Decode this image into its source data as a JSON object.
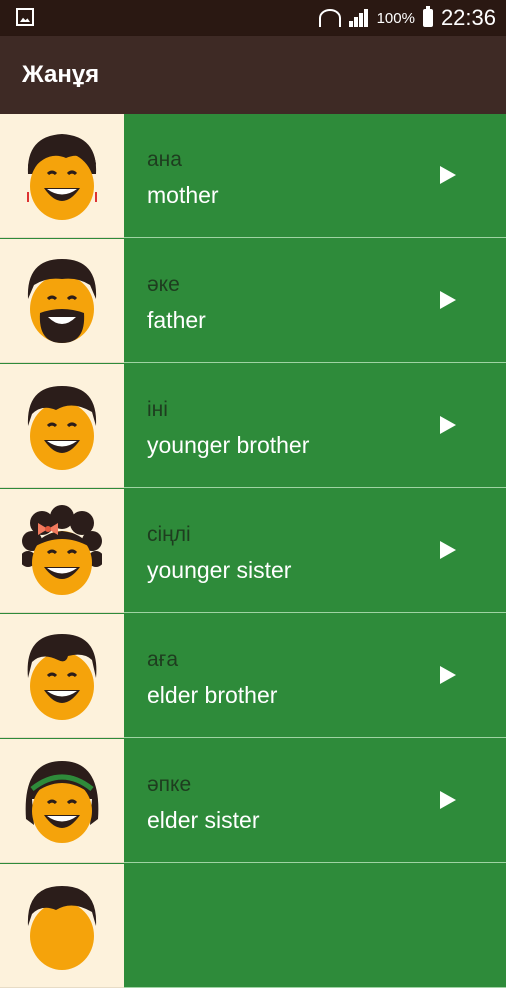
{
  "status": {
    "battery_pct": "100%",
    "time": "22:36"
  },
  "appbar": {
    "title": "Жанұя"
  },
  "items": [
    {
      "kz": "ана",
      "en": "mother",
      "avatar": "mother-face"
    },
    {
      "kz": "әке",
      "en": "father",
      "avatar": "father-face"
    },
    {
      "kz": "іні",
      "en": "younger brother",
      "avatar": "younger-brother-face"
    },
    {
      "kz": "сіңлі",
      "en": "younger sister",
      "avatar": "younger-sister-face"
    },
    {
      "kz": "аға",
      "en": "elder brother",
      "avatar": "elder-brother-face"
    },
    {
      "kz": "әпке",
      "en": "elder sister",
      "avatar": "elder-sister-face"
    },
    {
      "kz": "",
      "en": "",
      "avatar": "partial-face"
    }
  ],
  "colors": {
    "row_bg": "#2e8b3a",
    "avatar_bg": "#fdf2dc",
    "appbar": "#3e2a25",
    "status": "#2a1812",
    "face": "#f5a30b",
    "hair": "#2b1d1a"
  }
}
